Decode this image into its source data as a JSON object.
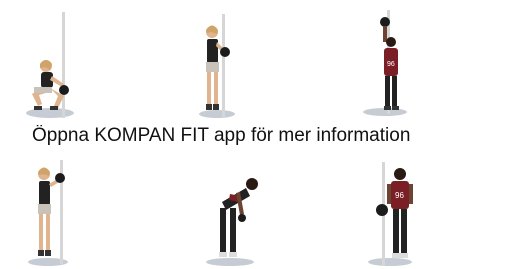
{
  "caption": "Öppna KOMPAN FIT app för mer information",
  "colors": {
    "pole": "#d6d6d6",
    "skin": "#e0b48e",
    "dark_skin": "#6b4432",
    "hair_blonde": "#cfa36a",
    "hair_dark": "#2a1a14",
    "black_top": "#222222",
    "maroon_shirt": "#7a1f25",
    "shorts_print": "#c9c2b8",
    "shadow": "#c6ccd4",
    "kettlebell": "#1c1c1c"
  },
  "exercises": [
    {
      "pose": "squat-kettlebell"
    },
    {
      "pose": "standing-front-hold"
    },
    {
      "pose": "overhead-press"
    },
    {
      "pose": "standing-side-hold"
    },
    {
      "pose": "bent-over-row"
    },
    {
      "pose": "standing-kettlebell-man"
    }
  ]
}
